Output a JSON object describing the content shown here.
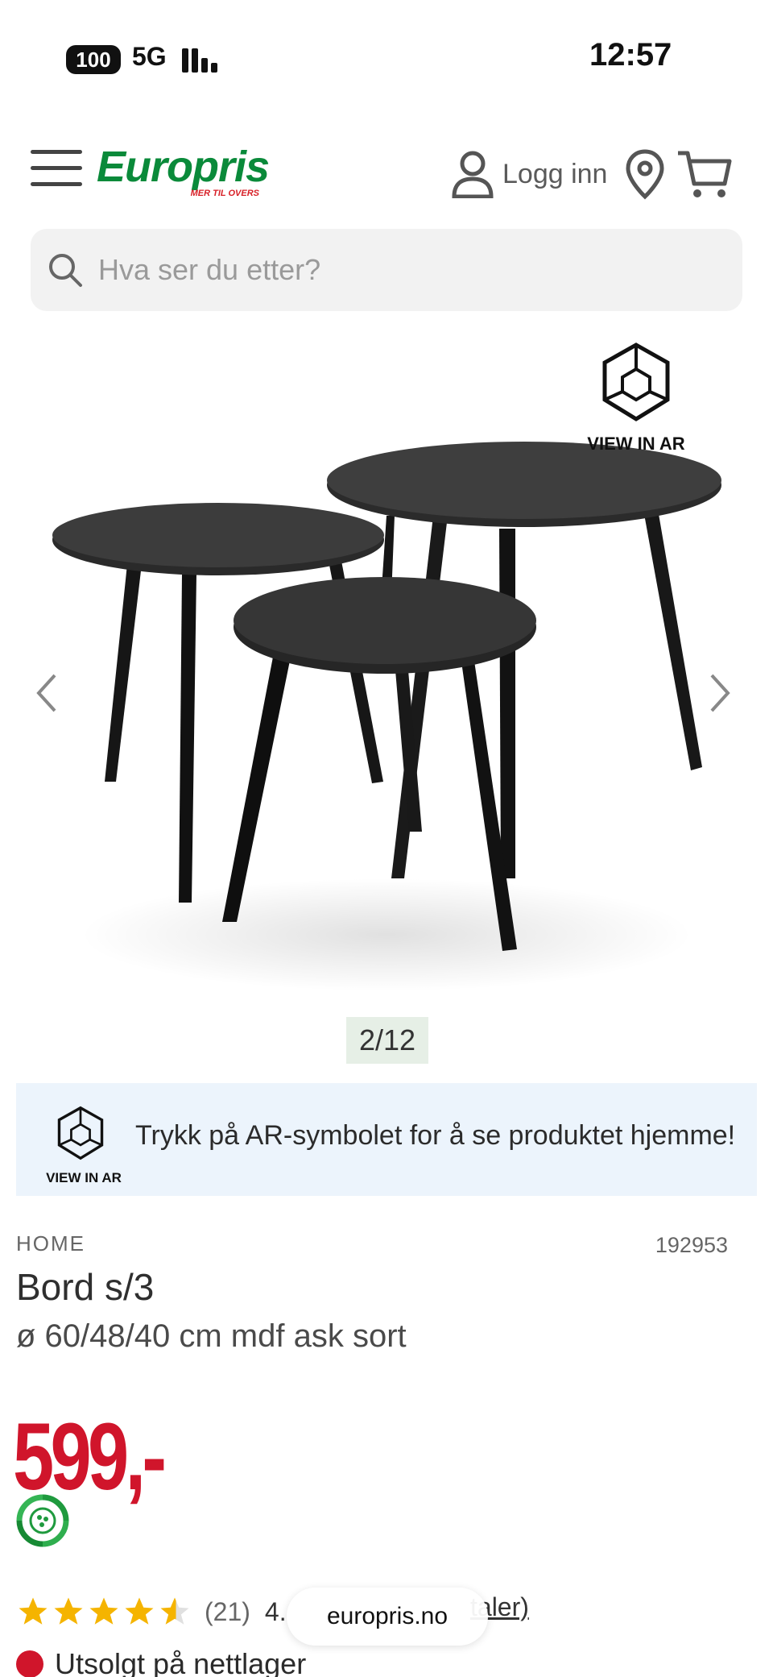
{
  "status_bar": {
    "battery": "100",
    "network": "5G",
    "time": "12:57"
  },
  "header": {
    "logo_text": "Europris",
    "logo_tagline": "MER TIL OVERS",
    "login_label": "Logg inn",
    "icons": {
      "menu": "menu-icon",
      "user": "user-icon",
      "location": "location-pin-icon",
      "cart": "cart-icon"
    }
  },
  "search": {
    "placeholder": "Hva ser du etter?"
  },
  "gallery": {
    "ar_label": "VIEW IN AR",
    "counter": "2/12"
  },
  "ar_banner": {
    "label": "VIEW IN AR",
    "text": "Trykk på AR-symbolet for å se produktet hjemme!"
  },
  "product": {
    "brand": "HOME",
    "sku": "192953",
    "title": "Bord s/3",
    "subtitle": "ø 60/48/40 cm mdf ask sort",
    "price": "599,-"
  },
  "rating": {
    "stars": 4.5,
    "count": "(21)",
    "extra": "4.",
    "link_text": "taler)"
  },
  "browser": {
    "url": "europris.no"
  },
  "stock": {
    "text": "Utsolgt på nettlager"
  },
  "colors": {
    "brand_green": "#0a8a3a",
    "price_red": "#d0152b",
    "star": "#f5b400",
    "banner_bg": "#ecf4fc"
  }
}
